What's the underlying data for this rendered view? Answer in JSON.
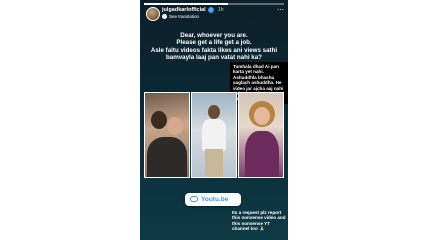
{
  "story": {
    "progress": 0.6,
    "username": "julgadkarlofficial",
    "time": "1h",
    "translate_label": "See translation",
    "more_icon": "more-icon",
    "caption": "Dear, whoever you are.\nPlease get a life get a job.\nAsle faltu videos fakta likes ani views sathi bamvayla laaj pan vatat nahi ka?",
    "reply_text": "Tumhala dhad Ai pan karta yet nahi. Ashuddhla bhasha saglach ashuddha. He video jar ajcha aaj nahi del zala tar lavkarach courtat bhetuyo..",
    "link_label": "Youtu.be",
    "link_icon": "link-icon",
    "note_text": "Its a request plz report this nonsense video and this nonsense YT channel too 🙏"
  },
  "colors": {
    "verified": "#3897f0",
    "link": "#3897f0"
  }
}
